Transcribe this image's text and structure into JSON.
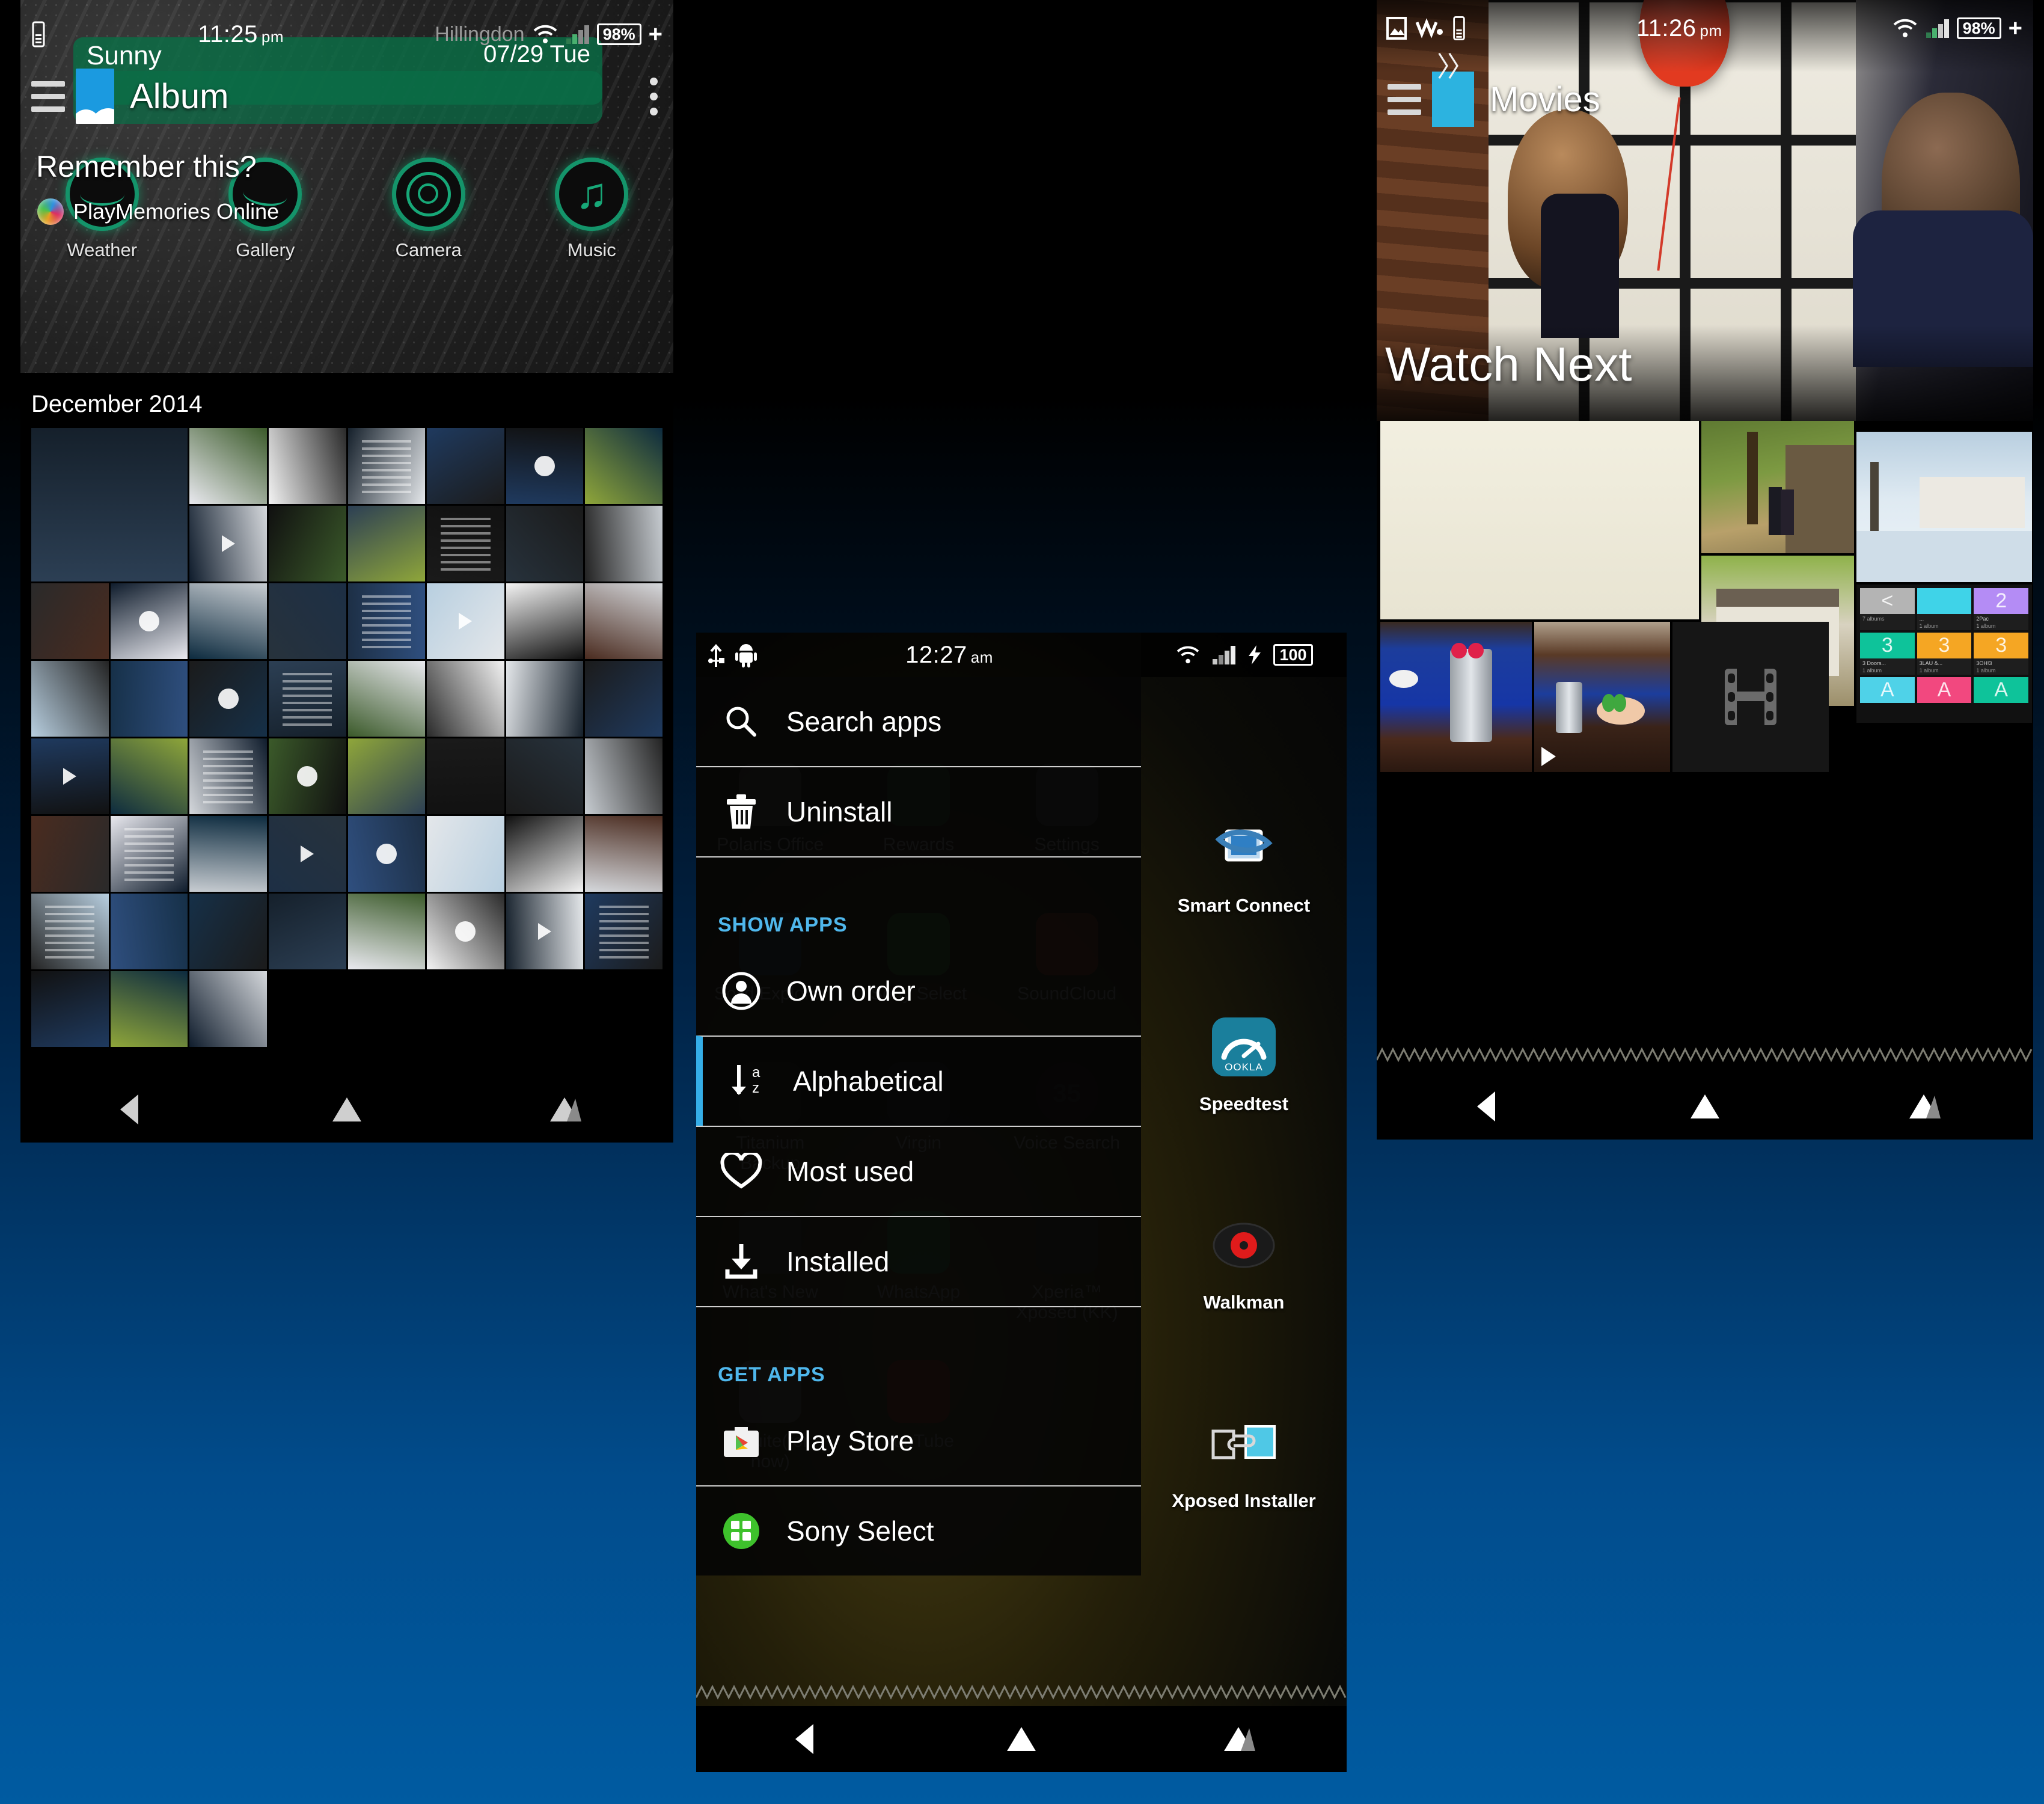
{
  "album_screen": {
    "status_bar": {
      "icons": [
        "usb-device-icon"
      ],
      "time": "11:25",
      "ampm": "pm",
      "network_name": "Hillingdon",
      "right_icons": [
        "wifi-icon",
        "signal-icon"
      ],
      "battery": "98%",
      "battery_plus": "+"
    },
    "weather_widget": {
      "condition": "Sunny",
      "date": "07/29 Tue"
    },
    "app_bar": {
      "menu_icon": "hamburger-icon",
      "app_icon": "album-icon",
      "title": "Album",
      "overflow_icon": "kebab-menu-icon"
    },
    "overlay": {
      "heading": "Remember this?",
      "service": "PlayMemories Online",
      "service_icon": "playmemories-orb-icon"
    },
    "dock": [
      {
        "label": "Weather",
        "icon": "weather-hill-icon"
      },
      {
        "label": "Gallery",
        "icon": "gallery-icon"
      },
      {
        "label": "Camera",
        "icon": "camera-lens-icon"
      },
      {
        "label": "Music",
        "icon": "music-note-icon"
      }
    ],
    "month_label": "December 2014",
    "nav_bar": [
      "back-button",
      "home-button",
      "recents-button"
    ]
  },
  "drawer_screen": {
    "status_bar": {
      "left_icons": [
        "usb-icon",
        "android-debug-icon"
      ],
      "time": "12:27",
      "ampm": "am",
      "right_icons": [
        "wifi-icon",
        "signal-icon",
        "charging-bolt-icon"
      ],
      "battery": "100"
    },
    "menu_items": [
      {
        "label": "Search apps",
        "icon": "search-icon",
        "selected": false
      },
      {
        "label": "Uninstall",
        "icon": "trash-icon",
        "selected": false
      },
      {
        "section": "SHOW APPS"
      },
      {
        "label": "Own order",
        "icon": "person-icon",
        "selected": false
      },
      {
        "label": "Alphabetical",
        "icon": "sort-az-icon",
        "selected": true
      },
      {
        "label": "Most used",
        "icon": "heart-icon",
        "selected": false
      },
      {
        "label": "Installed",
        "icon": "download-icon",
        "selected": false
      },
      {
        "section": "GET APPS"
      },
      {
        "label": "Play Store",
        "icon": "play-store-icon",
        "selected": false
      },
      {
        "label": "Sony Select",
        "icon": "sony-select-icon",
        "selected": false
      }
    ],
    "section_show_apps": "SHOW APPS",
    "section_get_apps": "GET APPS",
    "background_apps": [
      {
        "label": "Polaris Office",
        "icon": "polaris-office-icon"
      },
      {
        "label": "Rewards",
        "icon": "rewards-chart-icon"
      },
      {
        "label": "Settings",
        "icon": "settings-tools-icon"
      },
      {
        "label": "Solid Explorer",
        "icon": "solid-explorer-icon"
      },
      {
        "label": "Sony Select",
        "icon": "sony-select-icon"
      },
      {
        "label": "SoundCloud",
        "icon": "soundcloud-icon"
      },
      {
        "label": "Titanium Backup",
        "icon": "titanium-backup-icon"
      },
      {
        "label": "Virgin",
        "icon": "sim-card-icon"
      },
      {
        "label": "Voice Search",
        "icon": "voice-search-icon",
        "badge": "35"
      },
      {
        "label": "What's New",
        "icon": "whats-new-icon"
      },
      {
        "label": "WhatsApp",
        "icon": "whatsapp-icon"
      },
      {
        "label": "Xperia™ Xposed (KK)",
        "icon": "xperia-xposed-icon"
      },
      {
        "label": "xSuite(for now)",
        "icon": "xsuite-icon"
      },
      {
        "label": "YouTube",
        "icon": "youtube-icon"
      }
    ],
    "side_apps": [
      {
        "label": "Smart Connect",
        "icon": "smart-connect-icon"
      },
      {
        "label": "Speedtest",
        "icon": "ookla-speedtest-icon"
      },
      {
        "label": "Walkman",
        "icon": "walkman-icon"
      },
      {
        "label": "Xposed Installer",
        "icon": "xposed-installer-icon"
      }
    ],
    "nav_bar": [
      "back-button",
      "home-button",
      "recents-button"
    ]
  },
  "movies_screen": {
    "status_bar": {
      "left_icons": [
        "photo-icon",
        "walkman-icon",
        "usb-device-icon"
      ],
      "time": "11:26",
      "ampm": "pm",
      "right_icons": [
        "wifi-icon",
        "signal-icon"
      ],
      "battery": "98%",
      "battery_plus": "+"
    },
    "app_bar": {
      "menu_icon": "hamburger-icon",
      "app_icon": "movies-icon",
      "title": "Movies"
    },
    "section_title": "Watch Next",
    "music_tiles": [
      {
        "initial": "<",
        "name": "<unknown>",
        "sub": "7 albums",
        "color": "#b4b4b4"
      },
      {
        "initial": "",
        "name": "...",
        "sub": "1 album",
        "color": "#3fd3e8"
      },
      {
        "initial": "2",
        "name": "2Pac",
        "sub": "1 album",
        "color": "#b48cf5"
      },
      {
        "initial": "3",
        "name": "3 Doors...",
        "sub": "1 album",
        "color": "#0ec39a"
      },
      {
        "initial": "3",
        "name": "3LAU &...",
        "sub": "1 album",
        "color": "#f5a623"
      },
      {
        "initial": "3",
        "name": "3OH!3",
        "sub": "1 album",
        "color": "#f5a623"
      },
      {
        "initial": "A",
        "name": "",
        "sub": "",
        "color": "#4fd2e8"
      },
      {
        "initial": "A",
        "name": "",
        "sub": "",
        "color": "#f2487f"
      },
      {
        "initial": "A",
        "name": "",
        "sub": "",
        "color": "#0ec39a"
      }
    ],
    "nav_bar": [
      "back-button",
      "home-button",
      "recents-button"
    ]
  }
}
